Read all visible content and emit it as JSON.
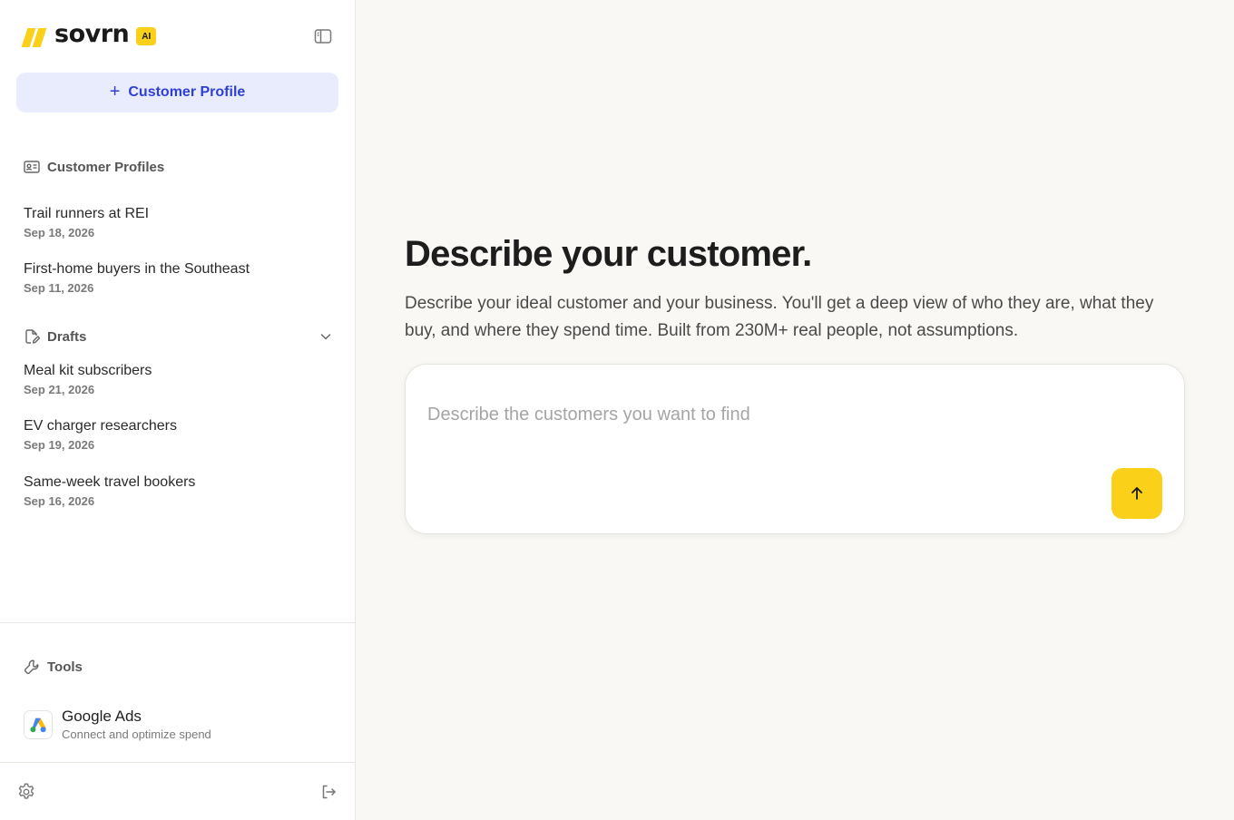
{
  "brand": {
    "name": "sovrn",
    "badge": "AI",
    "accent": "#fbd019"
  },
  "sidebar": {
    "new_profile_label": "Customer Profile",
    "profiles_section": {
      "title": "Customer Profiles",
      "items": [
        {
          "title": "Trail runners at REI",
          "date": "Sep 18, 2026"
        },
        {
          "title": "First-home buyers in the Southeast",
          "date": "Sep 11, 2026"
        }
      ]
    },
    "drafts_section": {
      "title": "Drafts",
      "items": [
        {
          "title": "Meal kit subscribers",
          "date": "Sep 21, 2026"
        },
        {
          "title": "EV charger researchers",
          "date": "Sep 19, 2026"
        },
        {
          "title": "Same-week travel bookers",
          "date": "Sep 16, 2026"
        }
      ]
    },
    "tools_section": {
      "title": "Tools",
      "items": [
        {
          "title": "Google Ads",
          "subtitle": "Connect and optimize spend",
          "icon": "google-ads-icon"
        }
      ]
    },
    "footer": {
      "settings_icon": "gear-icon",
      "logout_icon": "logout-icon"
    }
  },
  "main": {
    "title": "Describe your customer.",
    "subtitle": "Describe your ideal customer and your business. You'll get a deep view of who they are, what they buy, and where they spend time. Built from 230M+ real people, not assumptions.",
    "prompt": {
      "placeholder": "Describe the customers you want to find",
      "value": ""
    },
    "send_icon": "arrow-up-icon"
  },
  "colors": {
    "primary_button_bg": "#e9ecfd",
    "primary_button_text": "#2f3fd6",
    "send_button": "#fbd019"
  }
}
